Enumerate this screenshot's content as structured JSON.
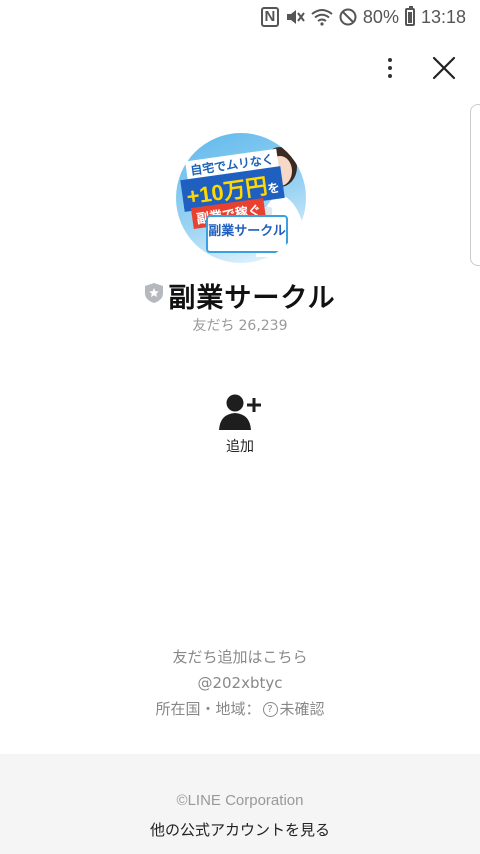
{
  "status_bar": {
    "battery_percent": "80%",
    "time": "13:18"
  },
  "icons": {
    "more": "more-vertical-icon",
    "close": "close-icon",
    "add_friend": "add-friend-icon",
    "badge": "shield-star-icon",
    "help": "question-icon"
  },
  "profile": {
    "avatar_banner": {
      "line1": "自宅でムリなく",
      "line2": "+10万円",
      "line2_suffix": "を",
      "line3": "副業で稼ぐ",
      "logo": "副業サークル"
    },
    "name": "副業サークル",
    "friends_label": "友だち",
    "friends_count": "26,239"
  },
  "actions": {
    "add_label": "追加"
  },
  "info": {
    "add_friend_text": "友だち追加はこちら",
    "line_id": "@202xbtyc",
    "location_label": "所在国・地域：",
    "location_value": "未確認"
  },
  "footer": {
    "copyright": "©LINE Corporation",
    "other_accounts": "他の公式アカウントを見る"
  },
  "colors": {
    "background": "#ffffff",
    "footer_bg": "#f5f5f5",
    "muted_text": "#999999",
    "avatar_blue": "#5fb8ec"
  }
}
